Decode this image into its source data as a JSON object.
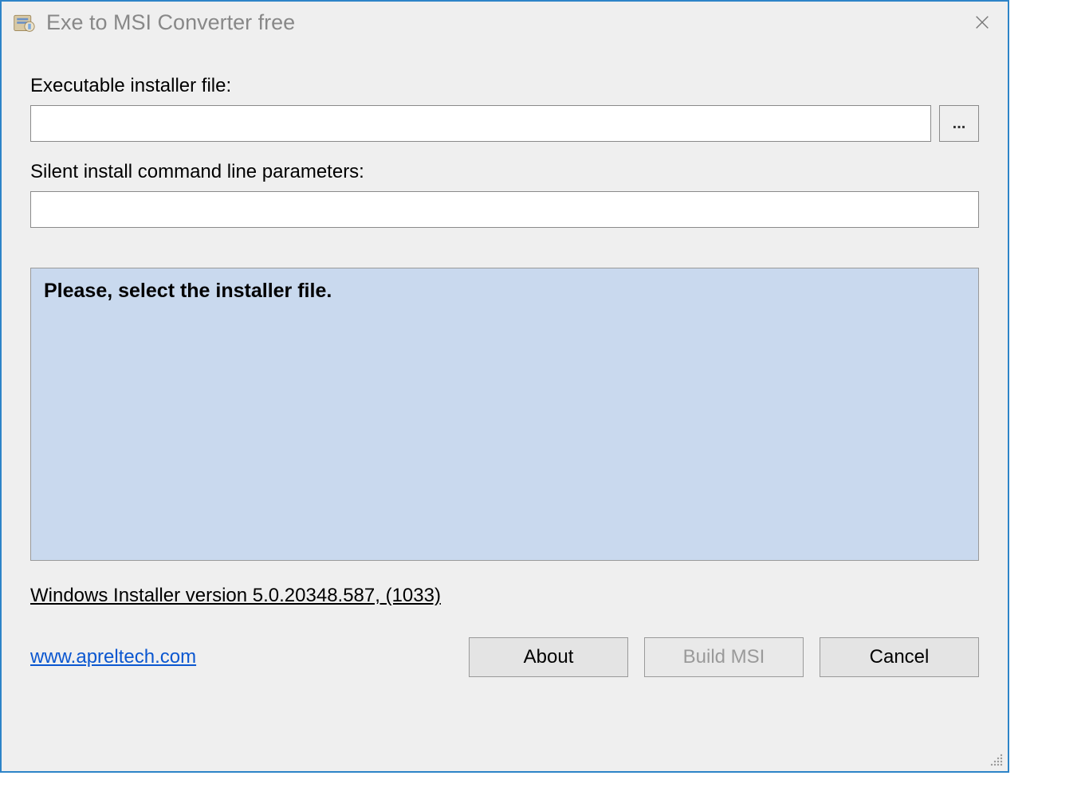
{
  "window": {
    "title": "Exe to MSI Converter free"
  },
  "labels": {
    "executable": "Executable installer file:",
    "silent_params": "Silent install command line parameters:"
  },
  "inputs": {
    "executable_value": "",
    "silent_params_value": ""
  },
  "browse": {
    "label": "..."
  },
  "status": {
    "message": "Please, select the installer file."
  },
  "version_info": "Windows Installer version 5.0.20348.587, (1033)",
  "link": {
    "text": "www.apreltech.com"
  },
  "buttons": {
    "about": "About",
    "build": "Build MSI",
    "cancel": "Cancel"
  }
}
